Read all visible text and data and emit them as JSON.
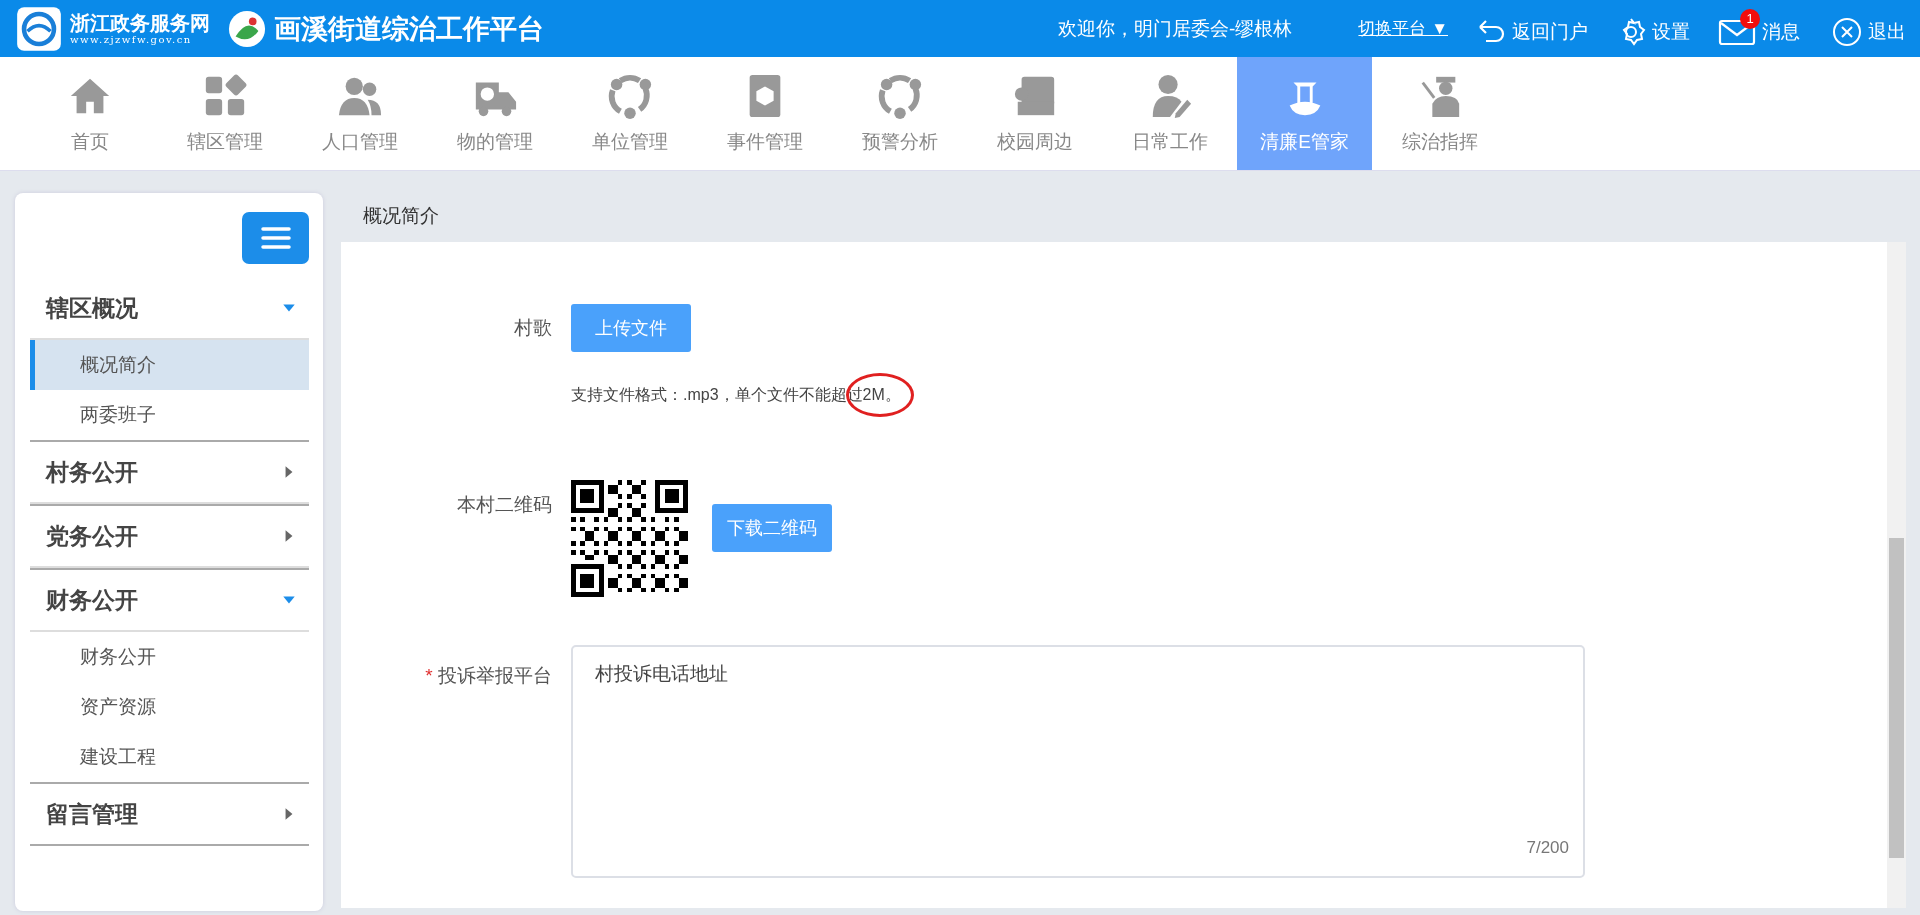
{
  "header": {
    "site_name": "浙江政务服务网",
    "site_url": "www.zjzwfw.gov.cn",
    "platform_title": "画溪街道综治工作平台",
    "welcome": "欢迎你，明门居委会-缪根林",
    "switch_platform": "切换平台 ▼",
    "actions": [
      {
        "kind": "back",
        "label": "返回门户"
      },
      {
        "kind": "settings",
        "label": "设置"
      },
      {
        "kind": "messages",
        "label": "消息",
        "badge": "1"
      },
      {
        "kind": "logout",
        "label": "退出"
      }
    ]
  },
  "nav": [
    {
      "label": "首页",
      "selected": false
    },
    {
      "label": "辖区管理",
      "selected": false
    },
    {
      "label": "人口管理",
      "selected": false
    },
    {
      "label": "物的管理",
      "selected": false
    },
    {
      "label": "单位管理",
      "selected": false
    },
    {
      "label": "事件管理",
      "selected": false
    },
    {
      "label": "预警分析",
      "selected": false
    },
    {
      "label": "校园周边",
      "selected": false
    },
    {
      "label": "日常工作",
      "selected": false
    },
    {
      "label": "清廉E管家",
      "selected": true
    },
    {
      "label": "综治指挥",
      "selected": false
    }
  ],
  "sidebar": {
    "groups": [
      {
        "label": "辖区概况",
        "expanded": true,
        "children": [
          {
            "label": "概况简介",
            "selected": true
          },
          {
            "label": "两委班子",
            "selected": false
          }
        ]
      },
      {
        "label": "村务公开",
        "expanded": false
      },
      {
        "label": "党务公开",
        "expanded": false
      },
      {
        "label": "财务公开",
        "expanded": true,
        "children": [
          {
            "label": "财务公开",
            "selected": false
          },
          {
            "label": "资产资源",
            "selected": false
          },
          {
            "label": "建设工程",
            "selected": false
          }
        ]
      },
      {
        "label": "留言管理",
        "expanded": false
      }
    ]
  },
  "breadcrumb": "概况简介",
  "form": {
    "song": {
      "label": "村歌",
      "button": "上传文件",
      "hint": "支持文件格式：.mp3，单个文件不能超过2M。"
    },
    "qr": {
      "label": "本村二维码",
      "button": "下载二维码"
    },
    "complaint": {
      "label": "投诉举报平台",
      "required_mark": "*",
      "value": "村投诉电话地址",
      "counter": "7/200"
    }
  }
}
